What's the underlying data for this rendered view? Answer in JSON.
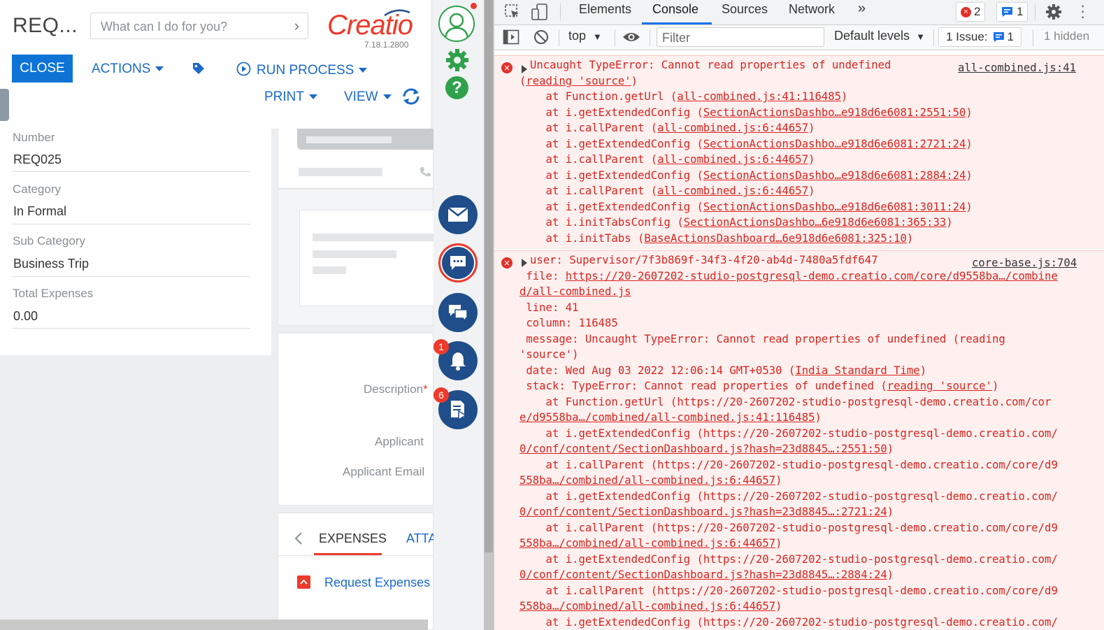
{
  "app": {
    "page_title": "REQ...",
    "search_placeholder": "What can I do for you?",
    "logo_text": "Creatio",
    "version": "7.18.1.2800",
    "toolbar": {
      "close": "CLOSE",
      "actions": "ACTIONS",
      "run_process": "RUN PROCESS",
      "print": "PRINT",
      "view": "VIEW"
    },
    "fields": [
      {
        "label": "Number",
        "value": "REQ025"
      },
      {
        "label": "Category",
        "value": "In Formal"
      },
      {
        "label": "Sub Category",
        "value": "Business Trip"
      },
      {
        "label": "Total Expenses",
        "value": "0.00"
      }
    ],
    "details": {
      "description": "Description",
      "required_mark": "*",
      "applicant": "Applicant",
      "applicant_email": "Applicant Email"
    },
    "tabs": {
      "expenses": "EXPENSES",
      "attachments": "ATTA",
      "request_expenses": "Request Expenses"
    }
  },
  "comm_panel": {
    "notifications_badge": "1",
    "feed_badge": "6"
  },
  "devtools": {
    "tabs": [
      "Elements",
      "Console",
      "Sources",
      "Network"
    ],
    "active_tab": "Console",
    "more": "»",
    "error_count": "2",
    "message_count": "1",
    "context": "top",
    "filter_placeholder": "Filter",
    "levels": "Default levels",
    "issues_label": "1 Issue:",
    "issues_count": "1",
    "hidden": "1 hidden",
    "error1": {
      "source": "all-combined.js:41",
      "lines": [
        "Uncaught TypeError: Cannot read properties of undefined",
        "(reading 'source')",
        "    at Function.getUrl (all-combined.js:41:116485)",
        "    at i.getExtendedConfig (SectionActionsDashbo…e918d6e6081:2551:50)",
        "    at i.callParent (all-combined.js:6:44657)",
        "    at i.getExtendedConfig (SectionActionsDashbo…e918d6e6081:2721:24)",
        "    at i.callParent (all-combined.js:6:44657)",
        "    at i.getExtendedConfig (SectionActionsDashbo…e918d6e6081:2884:24)",
        "    at i.callParent (all-combined.js:6:44657)",
        "    at i.getExtendedConfig (SectionActionsDashbo…e918d6e6081:3011:24)",
        "    at i.initTabsConfig (SectionActionsDashbo…6e918d6e6081:365:33)",
        "    at i.initTabs (BaseActionsDashboard…6e918d6e6081:325:10)"
      ]
    },
    "error2": {
      "source": "core-base.js:704",
      "lines": [
        "user: Supervisor/7f3b869f-34f3-4f20-ab4d-7480a5fdf647",
        " file: https://20-2607202-studio-postgresql-demo.creatio.com/core/d9558ba…/combine",
        "d/all-combined.js",
        " line: 41",
        " column: 116485",
        " message: Uncaught TypeError: Cannot read properties of undefined (reading",
        "'source')",
        " date: Wed Aug 03 2022 12:06:14 GMT+0530 (India Standard Time)",
        " stack: TypeError: Cannot read properties of undefined (reading 'source')",
        "    at Function.getUrl (https://20-2607202-studio-postgresql-demo.creatio.com/cor",
        "e/d9558ba…/combined/all-combined.js:41:116485)",
        "    at i.getExtendedConfig (https://20-2607202-studio-postgresql-demo.creatio.com/",
        "0/conf/content/SectionDashboard.js?hash=23d8845…:2551:50)",
        "    at i.callParent (https://20-2607202-studio-postgresql-demo.creatio.com/core/d9",
        "558ba…/combined/all-combined.js:6:44657)",
        "    at i.getExtendedConfig (https://20-2607202-studio-postgresql-demo.creatio.com/",
        "0/conf/content/SectionDashboard.js?hash=23d8845…:2721:24)",
        "    at i.callParent (https://20-2607202-studio-postgresql-demo.creatio.com/core/d9",
        "558ba…/combined/all-combined.js:6:44657)",
        "    at i.getExtendedConfig (https://20-2607202-studio-postgresql-demo.creatio.com/",
        "0/conf/content/SectionDashboard.js?hash=23d8845…:2884:24)",
        "    at i.callParent (https://20-2607202-studio-postgresql-demo.creatio.com/core/d9",
        "558ba…/combined/all-combined.js:6:44657)",
        "    at i.getExtendedConfig (https://20-2607202-studio-postgresql-demo.creatio.com/"
      ]
    }
  }
}
